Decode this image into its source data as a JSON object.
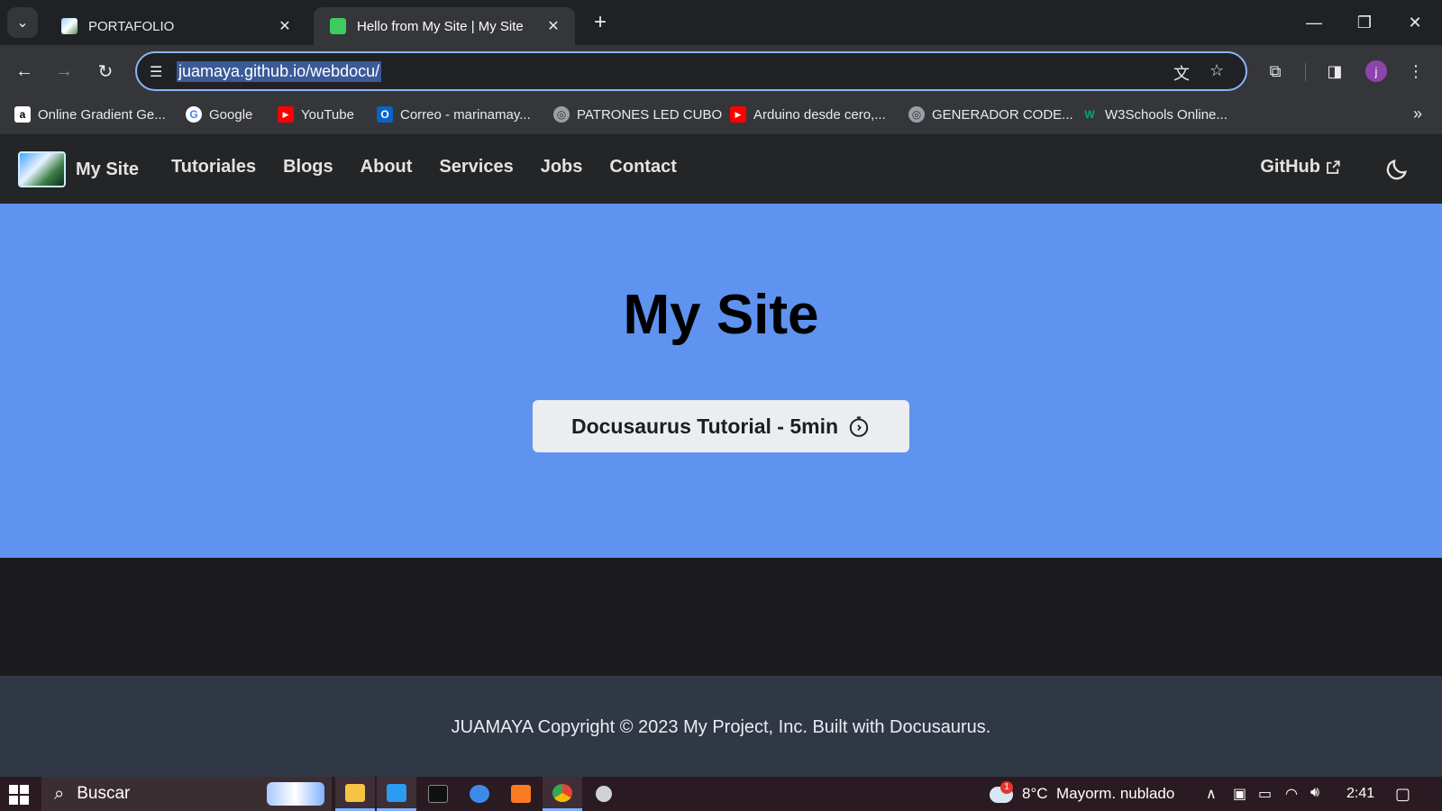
{
  "browser": {
    "tabs": [
      {
        "title": "PORTAFOLIO",
        "active": false
      },
      {
        "title": "Hello from My Site | My Site",
        "active": true
      }
    ],
    "url": "juamaya.github.io/webdocu/",
    "profile_initial": "j",
    "bookmarks": [
      {
        "label": "Online Gradient Ge...",
        "icon": "amazon-a-icon"
      },
      {
        "label": "Google",
        "icon": "google-icon"
      },
      {
        "label": "YouTube",
        "icon": "youtube-icon"
      },
      {
        "label": "Correo - marinamay...",
        "icon": "outlook-icon"
      },
      {
        "label": "PATRONES LED CUBO",
        "icon": "globe-icon"
      },
      {
        "label": "Arduino desde cero,...",
        "icon": "youtube-icon"
      },
      {
        "label": "GENERADOR CODE...",
        "icon": "globe-icon"
      },
      {
        "label": "W3Schools Online...",
        "icon": "w3schools-icon"
      }
    ]
  },
  "site": {
    "brand": "My Site",
    "nav": [
      "Tutoriales",
      "Blogs",
      "About",
      "Services",
      "Jobs",
      "Contact"
    ],
    "github": "GitHub",
    "hero": {
      "title": "My Site",
      "cta": "Docusaurus Tutorial - 5min"
    },
    "footer": "JUAMAYA Copyright © 2023 My Project, Inc. Built with Docusaurus."
  },
  "taskbar": {
    "search_placeholder": "Buscar",
    "weather": "8°C  Mayorm. nublado",
    "weather_badge": "1",
    "time": "2:41"
  },
  "colors": {
    "hero_bg": "#5f93ef",
    "navbar_bg": "#242526",
    "footer_bg": "#303846",
    "accent_blue": "#8ab4f8"
  }
}
